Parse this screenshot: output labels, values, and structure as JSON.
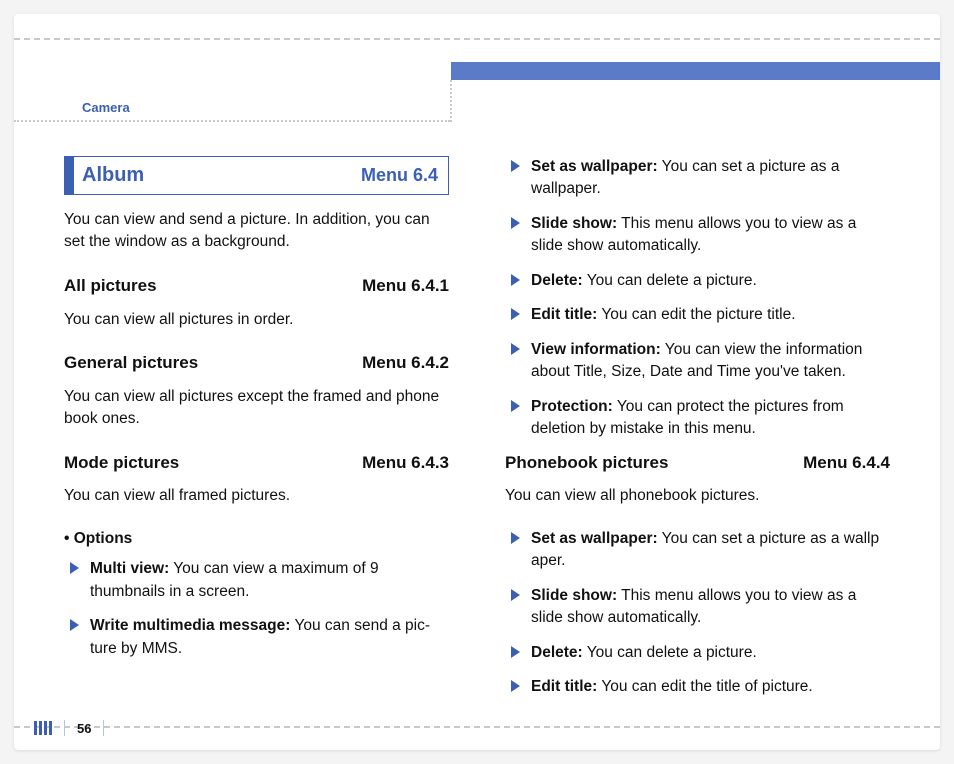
{
  "section": "Camera",
  "page_number": "56",
  "heading": {
    "title": "Album",
    "menu": "Menu 6.4"
  },
  "intro": "You can view and send a picture. In addition, you can set the window as a background.",
  "sub": {
    "all": {
      "title": "All pictures",
      "menu": "Menu 6.4.1",
      "desc": "You can view all pictures in order."
    },
    "gen": {
      "title": "General pictures",
      "menu": "Menu 6.4.2",
      "desc": "You can view all pictures except the framed and phone book ones."
    },
    "mode": {
      "title": "Mode pictures",
      "menu": "Menu 6.4.3",
      "desc": "You can view all framed pictures."
    },
    "phone": {
      "title": "Phonebook pictures",
      "menu": "Menu 6.4.4",
      "desc": "You can view all phonebook pictures."
    }
  },
  "options_label": "• Options",
  "mode_opts": [
    {
      "term": "Multi view:",
      "desc": " You can view a maximum of 9 thumbnails in a screen."
    },
    {
      "term": "Write multimedia message:",
      "desc": " You can send a pic-ture by MMS."
    },
    {
      "term": "Set as wallpaper:",
      "desc": " You can set a picture as a wallpaper."
    },
    {
      "term": "Slide show:",
      "desc": " This menu allows you to view as a slide show automatically."
    },
    {
      "term": "Delete:",
      "desc": " You can delete a picture."
    },
    {
      "term": "Edit title:",
      "desc": " You can edit the picture title."
    },
    {
      "term": "View information:",
      "desc": " You can view the information about Title, Size, Date and Time you've taken."
    },
    {
      "term": "Protection:",
      "desc": " You can protect the pictures from deletion by mistake in this menu."
    }
  ],
  "phone_opts": [
    {
      "term": "Set as wallpaper:",
      "desc": " You can set a picture as a wallp aper."
    },
    {
      "term": "Slide show:",
      "desc": " This menu allows you to view as a slide show automatically."
    },
    {
      "term": "Delete:",
      "desc": " You can delete a picture."
    },
    {
      "term": "Edit title:",
      "desc": " You can edit the title of picture."
    }
  ]
}
